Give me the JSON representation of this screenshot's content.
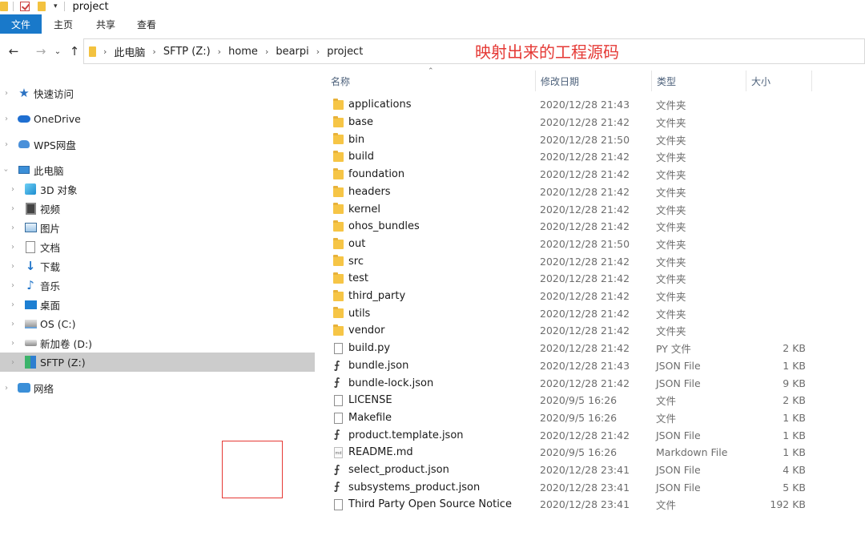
{
  "window": {
    "title": "project"
  },
  "ribbon": {
    "tabs": [
      {
        "label": "文件",
        "active": true
      },
      {
        "label": "主页"
      },
      {
        "label": "共享"
      },
      {
        "label": "查看"
      }
    ]
  },
  "address": {
    "crumbs": [
      "此电脑",
      "SFTP (Z:)",
      "home",
      "bearpi",
      "project"
    ]
  },
  "annotation": "映射出来的工程源码",
  "nav": {
    "items": [
      {
        "label": "快速访问",
        "icon": "star-icon"
      },
      {
        "label": "OneDrive",
        "icon": "cloud-icon"
      },
      {
        "label": "WPS网盘",
        "icon": "wps-cloud-icon"
      },
      {
        "label": "此电脑",
        "icon": "this-pc-icon"
      },
      {
        "label": "3D 对象",
        "icon": "3d-objects-icon"
      },
      {
        "label": "视频",
        "icon": "video-icon"
      },
      {
        "label": "图片",
        "icon": "pictures-icon"
      },
      {
        "label": "文档",
        "icon": "documents-icon"
      },
      {
        "label": "下载",
        "icon": "downloads-icon"
      },
      {
        "label": "音乐",
        "icon": "music-icon"
      },
      {
        "label": "桌面",
        "icon": "desktop-icon"
      },
      {
        "label": "OS (C:)",
        "icon": "os-drive-icon"
      },
      {
        "label": "新加卷 (D:)",
        "icon": "drive-icon"
      },
      {
        "label": "SFTP (Z:)",
        "icon": "sftp-drive-icon",
        "selected": true
      },
      {
        "label": "网络",
        "icon": "network-icon"
      }
    ]
  },
  "columns": {
    "name": "名称",
    "date": "修改日期",
    "type": "类型",
    "size": "大小"
  },
  "files": [
    {
      "name": "applications",
      "date": "2020/12/28 21:43",
      "type": "文件夹",
      "size": "",
      "icon": "folder-icon"
    },
    {
      "name": "base",
      "date": "2020/12/28 21:42",
      "type": "文件夹",
      "size": "",
      "icon": "folder-icon"
    },
    {
      "name": "bin",
      "date": "2020/12/28 21:50",
      "type": "文件夹",
      "size": "",
      "icon": "folder-icon"
    },
    {
      "name": "build",
      "date": "2020/12/28 21:42",
      "type": "文件夹",
      "size": "",
      "icon": "folder-icon"
    },
    {
      "name": "foundation",
      "date": "2020/12/28 21:42",
      "type": "文件夹",
      "size": "",
      "icon": "folder-icon"
    },
    {
      "name": "headers",
      "date": "2020/12/28 21:42",
      "type": "文件夹",
      "size": "",
      "icon": "folder-icon"
    },
    {
      "name": "kernel",
      "date": "2020/12/28 21:42",
      "type": "文件夹",
      "size": "",
      "icon": "folder-icon"
    },
    {
      "name": "ohos_bundles",
      "date": "2020/12/28 21:42",
      "type": "文件夹",
      "size": "",
      "icon": "folder-icon"
    },
    {
      "name": "out",
      "date": "2020/12/28 21:50",
      "type": "文件夹",
      "size": "",
      "icon": "folder-icon"
    },
    {
      "name": "src",
      "date": "2020/12/28 21:42",
      "type": "文件夹",
      "size": "",
      "icon": "folder-icon"
    },
    {
      "name": "test",
      "date": "2020/12/28 21:42",
      "type": "文件夹",
      "size": "",
      "icon": "folder-icon"
    },
    {
      "name": "third_party",
      "date": "2020/12/28 21:42",
      "type": "文件夹",
      "size": "",
      "icon": "folder-icon"
    },
    {
      "name": "utils",
      "date": "2020/12/28 21:42",
      "type": "文件夹",
      "size": "",
      "icon": "folder-icon"
    },
    {
      "name": "vendor",
      "date": "2020/12/28 21:42",
      "type": "文件夹",
      "size": "",
      "icon": "folder-icon"
    },
    {
      "name": "build.py",
      "date": "2020/12/28 21:42",
      "type": "PY 文件",
      "size": "2 KB",
      "icon": "file-icon"
    },
    {
      "name": "bundle.json",
      "date": "2020/12/28 21:43",
      "type": "JSON File",
      "size": "1 KB",
      "icon": "json-file-icon"
    },
    {
      "name": "bundle-lock.json",
      "date": "2020/12/28 21:42",
      "type": "JSON File",
      "size": "9 KB",
      "icon": "json-file-icon"
    },
    {
      "name": "LICENSE",
      "date": "2020/9/5 16:26",
      "type": "文件",
      "size": "2 KB",
      "icon": "file-icon"
    },
    {
      "name": "Makefile",
      "date": "2020/9/5 16:26",
      "type": "文件",
      "size": "1 KB",
      "icon": "file-icon"
    },
    {
      "name": "product.template.json",
      "date": "2020/12/28 21:42",
      "type": "JSON File",
      "size": "1 KB",
      "icon": "json-file-icon"
    },
    {
      "name": "README.md",
      "date": "2020/9/5 16:26",
      "type": "Markdown File",
      "size": "1 KB",
      "icon": "markdown-file-icon"
    },
    {
      "name": "select_product.json",
      "date": "2020/12/28 23:41",
      "type": "JSON File",
      "size": "4 KB",
      "icon": "json-file-icon"
    },
    {
      "name": "subsystems_product.json",
      "date": "2020/12/28 23:41",
      "type": "JSON File",
      "size": "5 KB",
      "icon": "json-file-icon"
    },
    {
      "name": "Third Party Open Source Notice",
      "date": "2020/12/28 23:41",
      "type": "文件",
      "size": "192 KB",
      "icon": "file-icon"
    }
  ]
}
